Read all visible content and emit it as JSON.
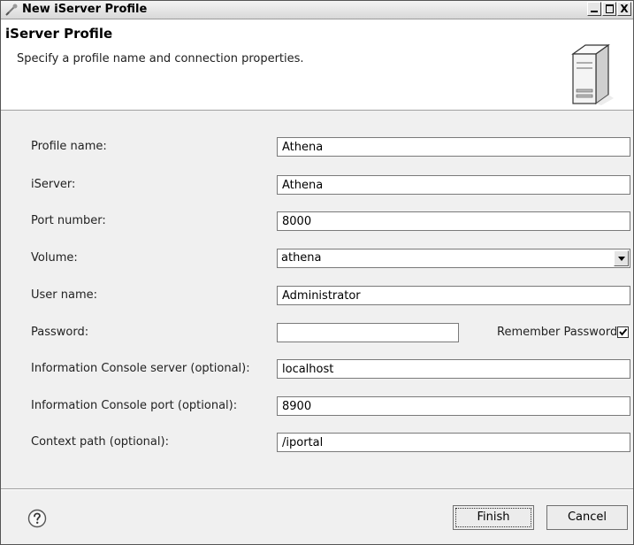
{
  "window": {
    "title": "New iServer Profile",
    "controls": [
      "minimize",
      "maximize",
      "close"
    ],
    "close_glyph": "X"
  },
  "header": {
    "title": "iServer Profile",
    "description": "Specify a profile name and connection properties.",
    "icon": "server-tower-icon"
  },
  "form": {
    "profile_name": {
      "label": "Profile name:",
      "value": "Athena"
    },
    "iserver": {
      "label": "iServer:",
      "value": "Athena"
    },
    "port_number": {
      "label": "Port number:",
      "value": "8000"
    },
    "volume": {
      "label": "Volume:",
      "value": "athena"
    },
    "user_name": {
      "label": "User name:",
      "value": "Administrator"
    },
    "password": {
      "label": "Password:",
      "value": ""
    },
    "remember_password": {
      "label": "Remember Password:",
      "checked": true
    },
    "ic_server": {
      "label": "Information Console server (optional):",
      "value": "localhost"
    },
    "ic_port": {
      "label": "Information Console port (optional):",
      "value": "8900"
    },
    "context_path": {
      "label": "Context path (optional):",
      "value": "/iportal"
    }
  },
  "footer": {
    "help_icon": "help-question-icon",
    "finish_label": "Finish",
    "cancel_label": "Cancel"
  }
}
